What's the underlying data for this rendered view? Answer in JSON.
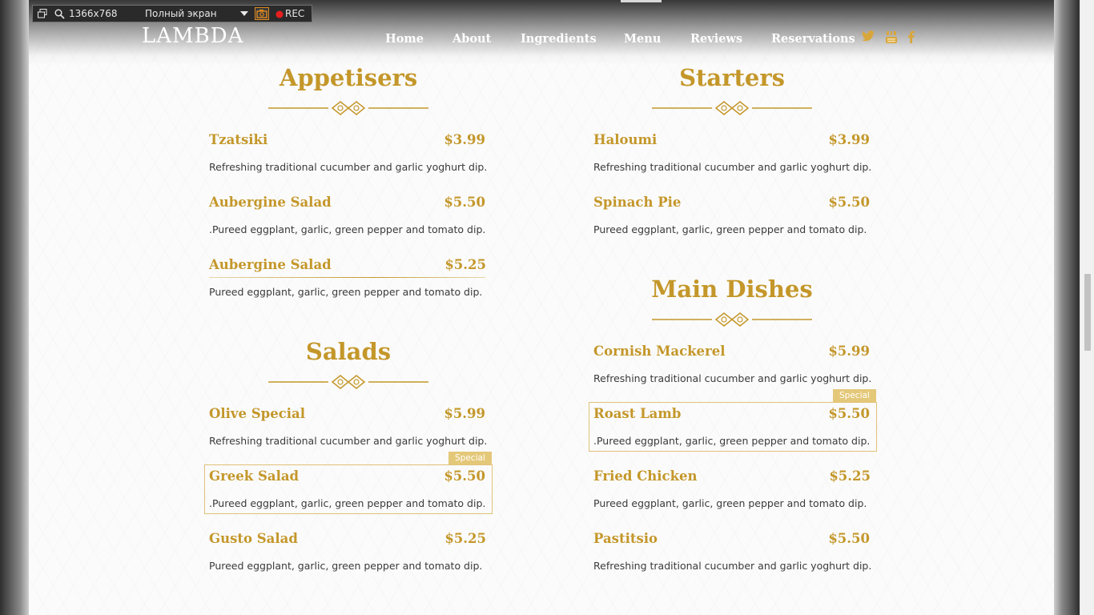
{
  "recorder": {
    "resolution": "1366x768",
    "mode": "Полный экран",
    "rec_label": "REC"
  },
  "header": {
    "logo": "LAMBDA",
    "nav": [
      "Home",
      "About",
      "Ingredients",
      "Menu",
      "Reviews",
      "Reservations"
    ],
    "social_icons": [
      "twitter-icon",
      "youtube-icon",
      "facebook-icon"
    ]
  },
  "menu": {
    "appetisers": {
      "title": "Appetisers",
      "items": [
        {
          "name": "Tzatsiki",
          "price": "$3.99",
          "desc": "Refreshing traditional cucumber and garlic yoghurt dip."
        },
        {
          "name": "Aubergine Salad",
          "price": "$5.50",
          "desc": ".Pureed eggplant, garlic, green pepper and tomato dip."
        },
        {
          "name": "Aubergine Salad",
          "price": "$5.25",
          "desc": "Pureed eggplant, garlic, green pepper and tomato dip."
        }
      ]
    },
    "starters": {
      "title": "Starters",
      "items": [
        {
          "name": "Haloumi",
          "price": "$3.99",
          "desc": "Refreshing traditional cucumber and garlic yoghurt dip."
        },
        {
          "name": "Spinach Pie",
          "price": "$5.50",
          "desc": "Pureed eggplant, garlic, green pepper and tomato dip."
        }
      ]
    },
    "salads": {
      "title": "Salads",
      "items": [
        {
          "name": "Olive Special",
          "price": "$5.99",
          "desc": "Refreshing traditional cucumber and garlic yoghurt dip."
        },
        {
          "name": "Greek Salad",
          "price": "$5.50",
          "desc": ".Pureed eggplant, garlic, green pepper and tomato dip.",
          "tag": "Special"
        },
        {
          "name": "Gusto Salad",
          "price": "$5.25",
          "desc": "Pureed eggplant, garlic, green pepper and tomato dip."
        }
      ]
    },
    "main_dishes": {
      "title": "Main Dishes",
      "items": [
        {
          "name": "Cornish Mackerel",
          "price": "$5.99",
          "desc": "Refreshing traditional cucumber and garlic yoghurt dip."
        },
        {
          "name": "Roast Lamb",
          "price": "$5.50",
          "desc": ".Pureed eggplant, garlic, green pepper and tomato dip.",
          "tag": "Special"
        },
        {
          "name": "Fried Chicken",
          "price": "$5.25",
          "desc": "Pureed eggplant, garlic, green pepper and tomato dip."
        },
        {
          "name": "Pastitsio",
          "price": "$5.50",
          "desc": "Refreshing traditional cucumber and garlic yoghurt dip."
        }
      ]
    }
  },
  "colors": {
    "gold": "#c4972a",
    "special_tag": "#e4c879",
    "text": "#3a3a3a"
  }
}
